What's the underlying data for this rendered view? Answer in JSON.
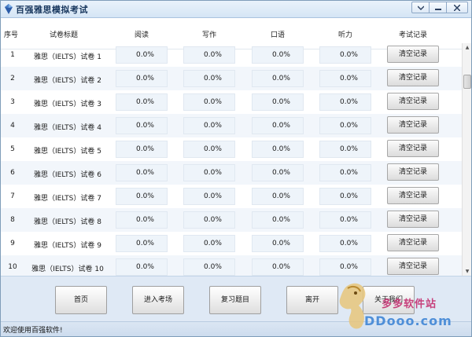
{
  "window": {
    "title": "百强雅思模拟考试",
    "controls": [
      "chevron-down-icon",
      "minimize-icon",
      "close-icon"
    ]
  },
  "table": {
    "headers": {
      "index": "序号",
      "title": "试卷标题",
      "reading": "阅读",
      "writing": "写作",
      "speaking": "口语",
      "listening": "听力",
      "record": "考试记录"
    },
    "rows": [
      {
        "index": "1",
        "title": "雅思（IELTS）试卷 1",
        "reading": "0.0%",
        "writing": "0.0%",
        "speaking": "0.0%",
        "listening": "0.0%",
        "action": "清空记录"
      },
      {
        "index": "2",
        "title": "雅思（IELTS）试卷 2",
        "reading": "0.0%",
        "writing": "0.0%",
        "speaking": "0.0%",
        "listening": "0.0%",
        "action": "清空记录"
      },
      {
        "index": "3",
        "title": "雅思（IELTS）试卷 3",
        "reading": "0.0%",
        "writing": "0.0%",
        "speaking": "0.0%",
        "listening": "0.0%",
        "action": "清空记录"
      },
      {
        "index": "4",
        "title": "雅思（IELTS）试卷 4",
        "reading": "0.0%",
        "writing": "0.0%",
        "speaking": "0.0%",
        "listening": "0.0%",
        "action": "清空记录"
      },
      {
        "index": "5",
        "title": "雅思（IELTS）试卷 5",
        "reading": "0.0%",
        "writing": "0.0%",
        "speaking": "0.0%",
        "listening": "0.0%",
        "action": "清空记录"
      },
      {
        "index": "6",
        "title": "雅思（IELTS）试卷 6",
        "reading": "0.0%",
        "writing": "0.0%",
        "speaking": "0.0%",
        "listening": "0.0%",
        "action": "清空记录"
      },
      {
        "index": "7",
        "title": "雅思（IELTS）试卷 7",
        "reading": "0.0%",
        "writing": "0.0%",
        "speaking": "0.0%",
        "listening": "0.0%",
        "action": "清空记录"
      },
      {
        "index": "8",
        "title": "雅思（IELTS）试卷 8",
        "reading": "0.0%",
        "writing": "0.0%",
        "speaking": "0.0%",
        "listening": "0.0%",
        "action": "清空记录"
      },
      {
        "index": "9",
        "title": "雅思（IELTS）试卷 9",
        "reading": "0.0%",
        "writing": "0.0%",
        "speaking": "0.0%",
        "listening": "0.0%",
        "action": "清空记录"
      },
      {
        "index": "10",
        "title": "雅思（IELTS）试卷 10",
        "reading": "0.0%",
        "writing": "0.0%",
        "speaking": "0.0%",
        "listening": "0.0%",
        "action": "清空记录"
      }
    ]
  },
  "bottombar": {
    "home": "首页",
    "enter_exam": "进入考场",
    "review": "复习题目",
    "exit": "离开",
    "about": "关于我们"
  },
  "status": {
    "text": "欢迎使用百强软件!"
  },
  "watermark": {
    "cn": "多多软件站",
    "en": "DDooo.com"
  }
}
